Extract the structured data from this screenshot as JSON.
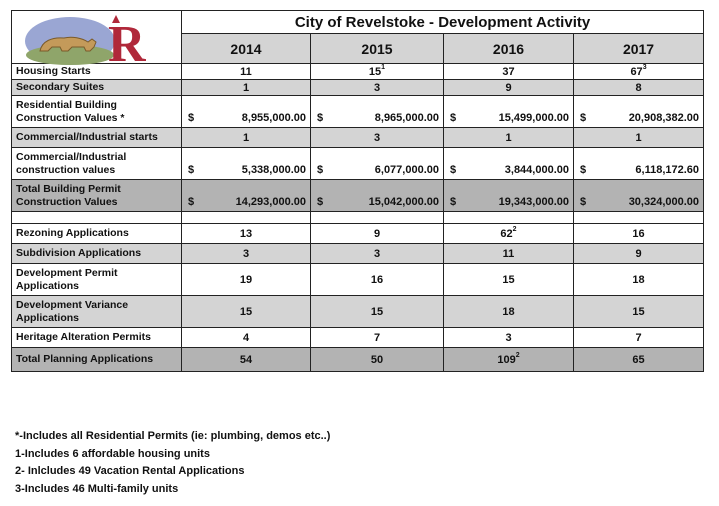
{
  "title": "City of Revelstoke - Development Activity",
  "logo_letter": "R",
  "years": [
    "2014",
    "2015",
    "2016",
    "2017"
  ],
  "rows": [
    {
      "label": "Housing Starts",
      "values": [
        "11",
        "15",
        "37",
        "67"
      ],
      "sups": [
        "",
        "1",
        "",
        "3"
      ]
    },
    {
      "label": "Secondary Suites",
      "values": [
        "1",
        "3",
        "9",
        "8"
      ]
    },
    {
      "label": "Residential Building Construction Values *",
      "money": true,
      "values": [
        "8,955,000.00",
        "8,965,000.00",
        "15,499,000.00",
        "20,908,382.00"
      ]
    },
    {
      "label": "Commercial/Industrial starts",
      "values": [
        "1",
        "3",
        "1",
        "1"
      ]
    },
    {
      "label": "Commercial/Industrial construction values",
      "money": true,
      "values": [
        "5,338,000.00",
        "6,077,000.00",
        "3,844,000.00",
        "6,118,172.60"
      ]
    },
    {
      "label": "Total Building Permit Construction Values",
      "money": true,
      "values": [
        "14,293,000.00",
        "15,042,000.00",
        "19,343,000.00",
        "30,324,000.00"
      ]
    },
    {
      "label": "Rezoning Applications",
      "values": [
        "13",
        "9",
        "62",
        "16"
      ],
      "sups": [
        "",
        "",
        "2",
        ""
      ]
    },
    {
      "label": "Subdivision Applications",
      "values": [
        "3",
        "3",
        "11",
        "9"
      ]
    },
    {
      "label": "Development Permit Applications",
      "values": [
        "19",
        "16",
        "15",
        "18"
      ]
    },
    {
      "label": "Development Variance Applications",
      "values": [
        "15",
        "15",
        "18",
        "15"
      ]
    },
    {
      "label": "Heritage Alteration Permits",
      "values": [
        "4",
        "7",
        "3",
        "7"
      ]
    },
    {
      "label": "Total Planning Applications",
      "values": [
        "54",
        "50",
        "109",
        "65"
      ],
      "sups": [
        "",
        "",
        "2",
        ""
      ]
    }
  ],
  "currency_symbol": "$",
  "notes": [
    "*-Includes all Residential Permits (ie: plumbing, demos etc..)",
    "1-Includes 6 affordable housing units",
    "2- Inlcludes 49 Vacation Rental Applications",
    "3-Includes 46 Multi-family units"
  ],
  "colors": {
    "row_shade": "#d4d4d4",
    "total_shade": "#b3b3b3",
    "logo_red": "#b0283a"
  }
}
